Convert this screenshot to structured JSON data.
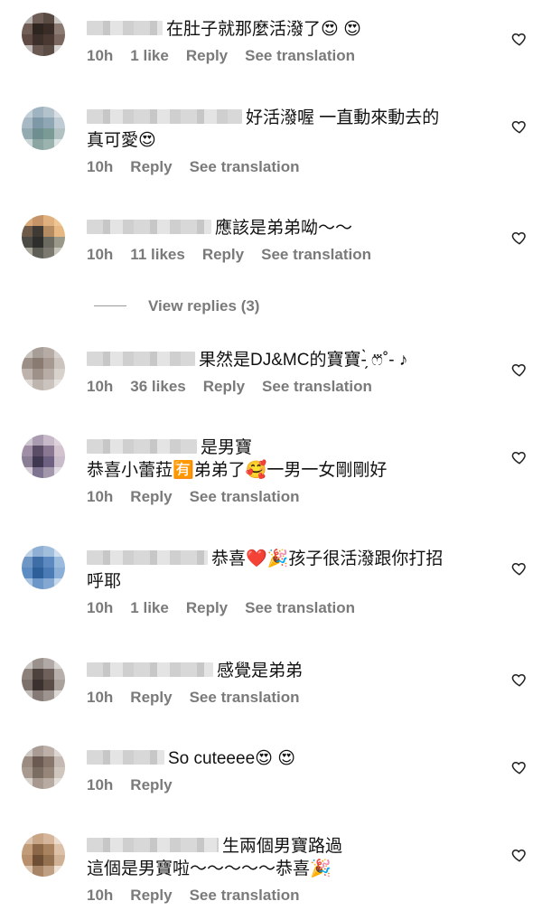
{
  "comments": [
    {
      "lines": [
        "在肚子就那麼活潑了😍 😍"
      ],
      "time": "10h",
      "likes": "1 like",
      "reply": "Reply",
      "translate": "See translation"
    },
    {
      "lines": [
        "好活潑喔 一直動來動去的",
        "真可愛😍"
      ],
      "time": "10h",
      "likes": "",
      "reply": "Reply",
      "translate": "See translation"
    },
    {
      "lines": [
        "應該是弟弟呦～～"
      ],
      "time": "10h",
      "likes": "11 likes",
      "reply": "Reply",
      "translate": "See translation"
    },
    {
      "lines": [
        "果然是DJ&MC的寶寶-̗̀ ෆ⃛˚- ♪"
      ],
      "time": "10h",
      "likes": "36 likes",
      "reply": "Reply",
      "translate": "See translation"
    },
    {
      "lines": [
        "是男寶",
        "恭喜小蕾菈🈶弟弟了🥰一男一女剛剛好"
      ],
      "time": "10h",
      "likes": "",
      "reply": "Reply",
      "translate": "See translation"
    },
    {
      "lines": [
        "恭喜❤️🎉孩子很活潑跟你打招",
        "呼耶"
      ],
      "time": "10h",
      "likes": "1 like",
      "reply": "Reply",
      "translate": "See translation"
    },
    {
      "lines": [
        "感覺是弟弟"
      ],
      "time": "10h",
      "likes": "",
      "reply": "Reply",
      "translate": "See translation"
    },
    {
      "lines": [
        "So cuteeee😍 😍"
      ],
      "time": "10h",
      "likes": "",
      "reply": "Reply",
      "translate": ""
    },
    {
      "lines": [
        "生兩個男寶路過",
        "這個是男寶啦～～～～～恭喜🎉"
      ],
      "time": "10h",
      "likes": "",
      "reply": "Reply",
      "translate": "See translation"
    }
  ],
  "view_replies": "View replies (3)",
  "icons": {
    "like": "heart-outline-icon",
    "avatar": "blurred-avatar"
  },
  "colors": {
    "meta": "#7a7a7a",
    "text": "#111111"
  }
}
